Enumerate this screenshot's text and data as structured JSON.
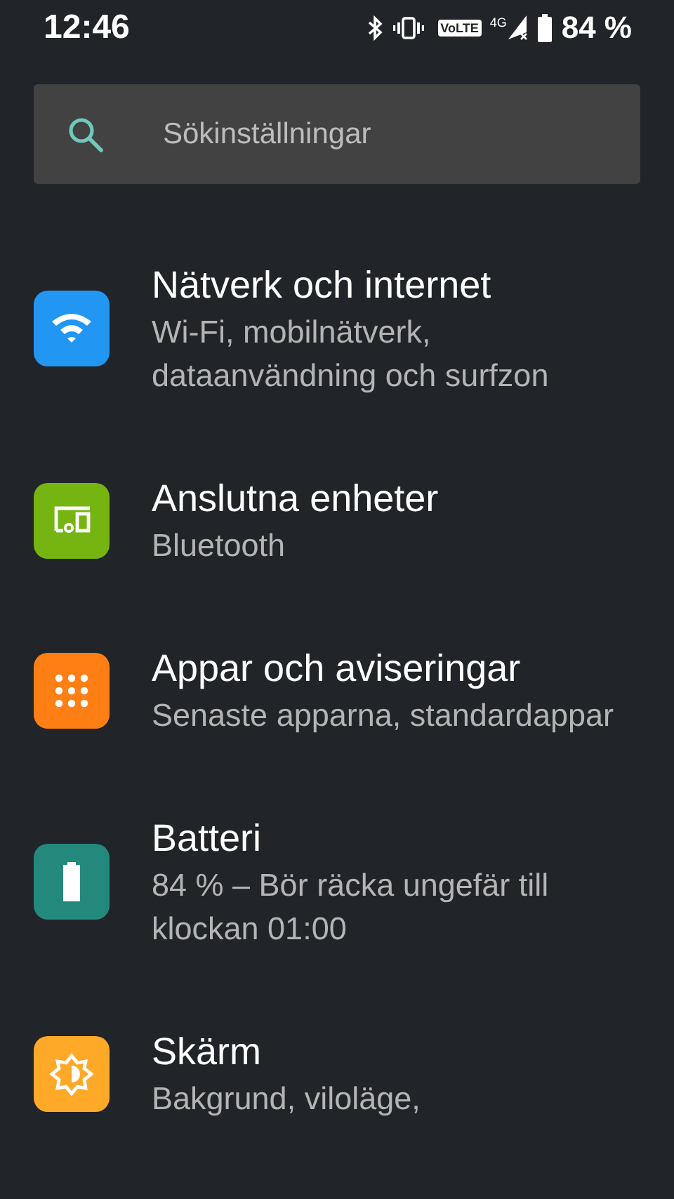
{
  "status_bar": {
    "time": "12:46",
    "volte": "VoLTE",
    "network": "4G",
    "battery_text": "84 %"
  },
  "search": {
    "placeholder": "Sökinställningar"
  },
  "items": [
    {
      "kind": "wifi",
      "color": "#2196f3",
      "title": "Nätverk och internet",
      "subtitle": "Wi-Fi, mobilnätverk, dataanvändning och surfzon"
    },
    {
      "kind": "devices",
      "color": "#76b511",
      "title": "Anslutna enheter",
      "subtitle": "Bluetooth"
    },
    {
      "kind": "apps",
      "color": "#ff7f14",
      "title": "Appar och aviseringar",
      "subtitle": "Senaste apparna, standardappar"
    },
    {
      "kind": "battery",
      "color": "#23897c",
      "title": "Batteri",
      "subtitle": "84 % – Bör räcka ungefär till klockan 01:00"
    },
    {
      "kind": "display",
      "color": "#ffa928",
      "title": "Skärm",
      "subtitle": "Bakgrund, viloläge,"
    }
  ]
}
